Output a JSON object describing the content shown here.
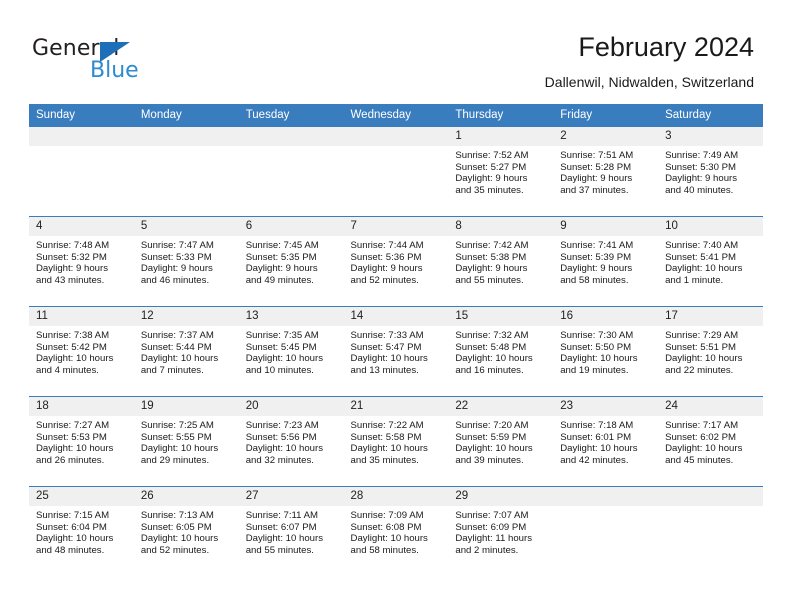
{
  "brand": {
    "name_part1": "General",
    "name_part2": "Blue",
    "triangle_color": "#1d6fb8",
    "blue_color": "#2e8bd0"
  },
  "header": {
    "title": "February 2024",
    "subtitle": "Dallenwil, Nidwalden, Switzerland"
  },
  "theme": {
    "header_bg": "#3a7dbf",
    "daynum_bg": "#f0f0f0",
    "rule_color": "#3a7dbf"
  },
  "weekdays": [
    "Sunday",
    "Monday",
    "Tuesday",
    "Wednesday",
    "Thursday",
    "Friday",
    "Saturday"
  ],
  "weeks": [
    [
      {
        "day": "",
        "lines": []
      },
      {
        "day": "",
        "lines": []
      },
      {
        "day": "",
        "lines": []
      },
      {
        "day": "",
        "lines": []
      },
      {
        "day": "1",
        "lines": [
          "Sunrise: 7:52 AM",
          "Sunset: 5:27 PM",
          "Daylight: 9 hours",
          "and 35 minutes."
        ]
      },
      {
        "day": "2",
        "lines": [
          "Sunrise: 7:51 AM",
          "Sunset: 5:28 PM",
          "Daylight: 9 hours",
          "and 37 minutes."
        ]
      },
      {
        "day": "3",
        "lines": [
          "Sunrise: 7:49 AM",
          "Sunset: 5:30 PM",
          "Daylight: 9 hours",
          "and 40 minutes."
        ]
      }
    ],
    [
      {
        "day": "4",
        "lines": [
          "Sunrise: 7:48 AM",
          "Sunset: 5:32 PM",
          "Daylight: 9 hours",
          "and 43 minutes."
        ]
      },
      {
        "day": "5",
        "lines": [
          "Sunrise: 7:47 AM",
          "Sunset: 5:33 PM",
          "Daylight: 9 hours",
          "and 46 minutes."
        ]
      },
      {
        "day": "6",
        "lines": [
          "Sunrise: 7:45 AM",
          "Sunset: 5:35 PM",
          "Daylight: 9 hours",
          "and 49 minutes."
        ]
      },
      {
        "day": "7",
        "lines": [
          "Sunrise: 7:44 AM",
          "Sunset: 5:36 PM",
          "Daylight: 9 hours",
          "and 52 minutes."
        ]
      },
      {
        "day": "8",
        "lines": [
          "Sunrise: 7:42 AM",
          "Sunset: 5:38 PM",
          "Daylight: 9 hours",
          "and 55 minutes."
        ]
      },
      {
        "day": "9",
        "lines": [
          "Sunrise: 7:41 AM",
          "Sunset: 5:39 PM",
          "Daylight: 9 hours",
          "and 58 minutes."
        ]
      },
      {
        "day": "10",
        "lines": [
          "Sunrise: 7:40 AM",
          "Sunset: 5:41 PM",
          "Daylight: 10 hours",
          "and 1 minute."
        ]
      }
    ],
    [
      {
        "day": "11",
        "lines": [
          "Sunrise: 7:38 AM",
          "Sunset: 5:42 PM",
          "Daylight: 10 hours",
          "and 4 minutes."
        ]
      },
      {
        "day": "12",
        "lines": [
          "Sunrise: 7:37 AM",
          "Sunset: 5:44 PM",
          "Daylight: 10 hours",
          "and 7 minutes."
        ]
      },
      {
        "day": "13",
        "lines": [
          "Sunrise: 7:35 AM",
          "Sunset: 5:45 PM",
          "Daylight: 10 hours",
          "and 10 minutes."
        ]
      },
      {
        "day": "14",
        "lines": [
          "Sunrise: 7:33 AM",
          "Sunset: 5:47 PM",
          "Daylight: 10 hours",
          "and 13 minutes."
        ]
      },
      {
        "day": "15",
        "lines": [
          "Sunrise: 7:32 AM",
          "Sunset: 5:48 PM",
          "Daylight: 10 hours",
          "and 16 minutes."
        ]
      },
      {
        "day": "16",
        "lines": [
          "Sunrise: 7:30 AM",
          "Sunset: 5:50 PM",
          "Daylight: 10 hours",
          "and 19 minutes."
        ]
      },
      {
        "day": "17",
        "lines": [
          "Sunrise: 7:29 AM",
          "Sunset: 5:51 PM",
          "Daylight: 10 hours",
          "and 22 minutes."
        ]
      }
    ],
    [
      {
        "day": "18",
        "lines": [
          "Sunrise: 7:27 AM",
          "Sunset: 5:53 PM",
          "Daylight: 10 hours",
          "and 26 minutes."
        ]
      },
      {
        "day": "19",
        "lines": [
          "Sunrise: 7:25 AM",
          "Sunset: 5:55 PM",
          "Daylight: 10 hours",
          "and 29 minutes."
        ]
      },
      {
        "day": "20",
        "lines": [
          "Sunrise: 7:23 AM",
          "Sunset: 5:56 PM",
          "Daylight: 10 hours",
          "and 32 minutes."
        ]
      },
      {
        "day": "21",
        "lines": [
          "Sunrise: 7:22 AM",
          "Sunset: 5:58 PM",
          "Daylight: 10 hours",
          "and 35 minutes."
        ]
      },
      {
        "day": "22",
        "lines": [
          "Sunrise: 7:20 AM",
          "Sunset: 5:59 PM",
          "Daylight: 10 hours",
          "and 39 minutes."
        ]
      },
      {
        "day": "23",
        "lines": [
          "Sunrise: 7:18 AM",
          "Sunset: 6:01 PM",
          "Daylight: 10 hours",
          "and 42 minutes."
        ]
      },
      {
        "day": "24",
        "lines": [
          "Sunrise: 7:17 AM",
          "Sunset: 6:02 PM",
          "Daylight: 10 hours",
          "and 45 minutes."
        ]
      }
    ],
    [
      {
        "day": "25",
        "lines": [
          "Sunrise: 7:15 AM",
          "Sunset: 6:04 PM",
          "Daylight: 10 hours",
          "and 48 minutes."
        ]
      },
      {
        "day": "26",
        "lines": [
          "Sunrise: 7:13 AM",
          "Sunset: 6:05 PM",
          "Daylight: 10 hours",
          "and 52 minutes."
        ]
      },
      {
        "day": "27",
        "lines": [
          "Sunrise: 7:11 AM",
          "Sunset: 6:07 PM",
          "Daylight: 10 hours",
          "and 55 minutes."
        ]
      },
      {
        "day": "28",
        "lines": [
          "Sunrise: 7:09 AM",
          "Sunset: 6:08 PM",
          "Daylight: 10 hours",
          "and 58 minutes."
        ]
      },
      {
        "day": "29",
        "lines": [
          "Sunrise: 7:07 AM",
          "Sunset: 6:09 PM",
          "Daylight: 11 hours",
          "and 2 minutes."
        ]
      },
      {
        "day": "",
        "lines": []
      },
      {
        "day": "",
        "lines": []
      }
    ]
  ]
}
